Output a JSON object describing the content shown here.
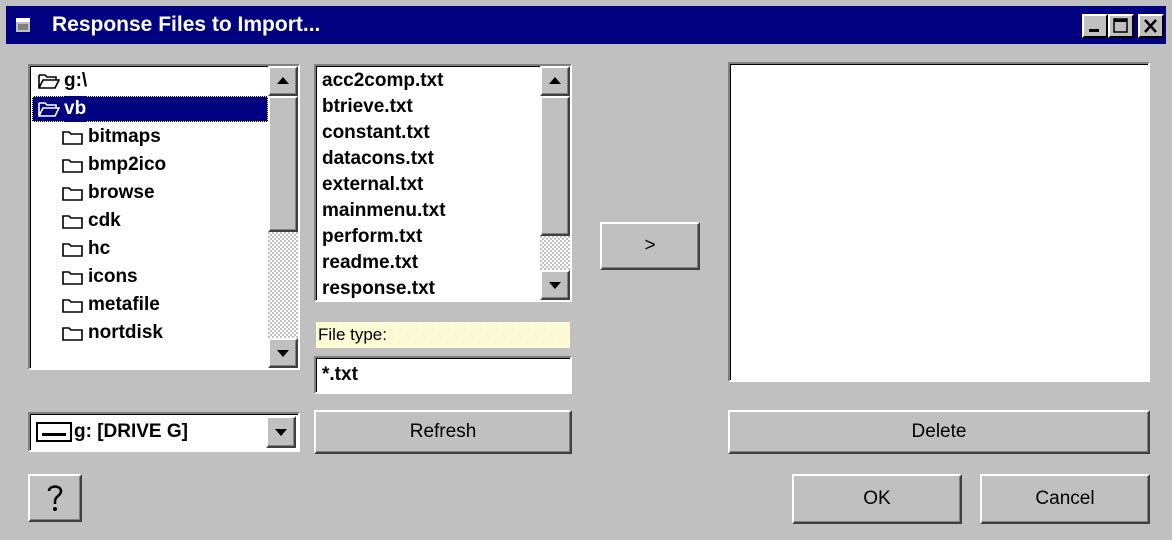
{
  "window": {
    "title": "Response Files to Import...",
    "controls": [
      "minimize-icon",
      "maximize-icon",
      "close-icon"
    ]
  },
  "directories": {
    "items": [
      {
        "label": "g:\\",
        "icon": "folder-open-icon",
        "level": 0,
        "selected": false
      },
      {
        "label": "vb",
        "icon": "folder-open-icon",
        "level": 1,
        "selected": true
      },
      {
        "label": "bitmaps",
        "icon": "folder-icon",
        "level": 2,
        "selected": false
      },
      {
        "label": "bmp2ico",
        "icon": "folder-icon",
        "level": 2,
        "selected": false
      },
      {
        "label": "browse",
        "icon": "folder-icon",
        "level": 2,
        "selected": false
      },
      {
        "label": "cdk",
        "icon": "folder-icon",
        "level": 2,
        "selected": false
      },
      {
        "label": "hc",
        "icon": "folder-icon",
        "level": 2,
        "selected": false
      },
      {
        "label": "icons",
        "icon": "folder-icon",
        "level": 2,
        "selected": false
      },
      {
        "label": "metafile",
        "icon": "folder-icon",
        "level": 2,
        "selected": false
      },
      {
        "label": "nortdisk",
        "icon": "folder-icon",
        "level": 2,
        "selected": false
      }
    ]
  },
  "files": {
    "items": [
      "acc2comp.txt",
      "btrieve.txt",
      "constant.txt",
      "datacons.txt",
      "external.txt",
      "mainmenu.txt",
      "perform.txt",
      "readme.txt",
      "response.txt"
    ]
  },
  "file_type": {
    "label": "File type:",
    "value": "*.txt"
  },
  "drive": {
    "value": "g: [DRIVE G]",
    "icon": "drive-icon"
  },
  "buttons": {
    "move": ">",
    "refresh": "Refresh",
    "delete": "Delete",
    "ok": "OK",
    "cancel": "Cancel",
    "help_icon": "help-icon"
  },
  "colors": {
    "title_bar": "#000080",
    "selection": "#000080",
    "face": "#c0c0c0"
  }
}
